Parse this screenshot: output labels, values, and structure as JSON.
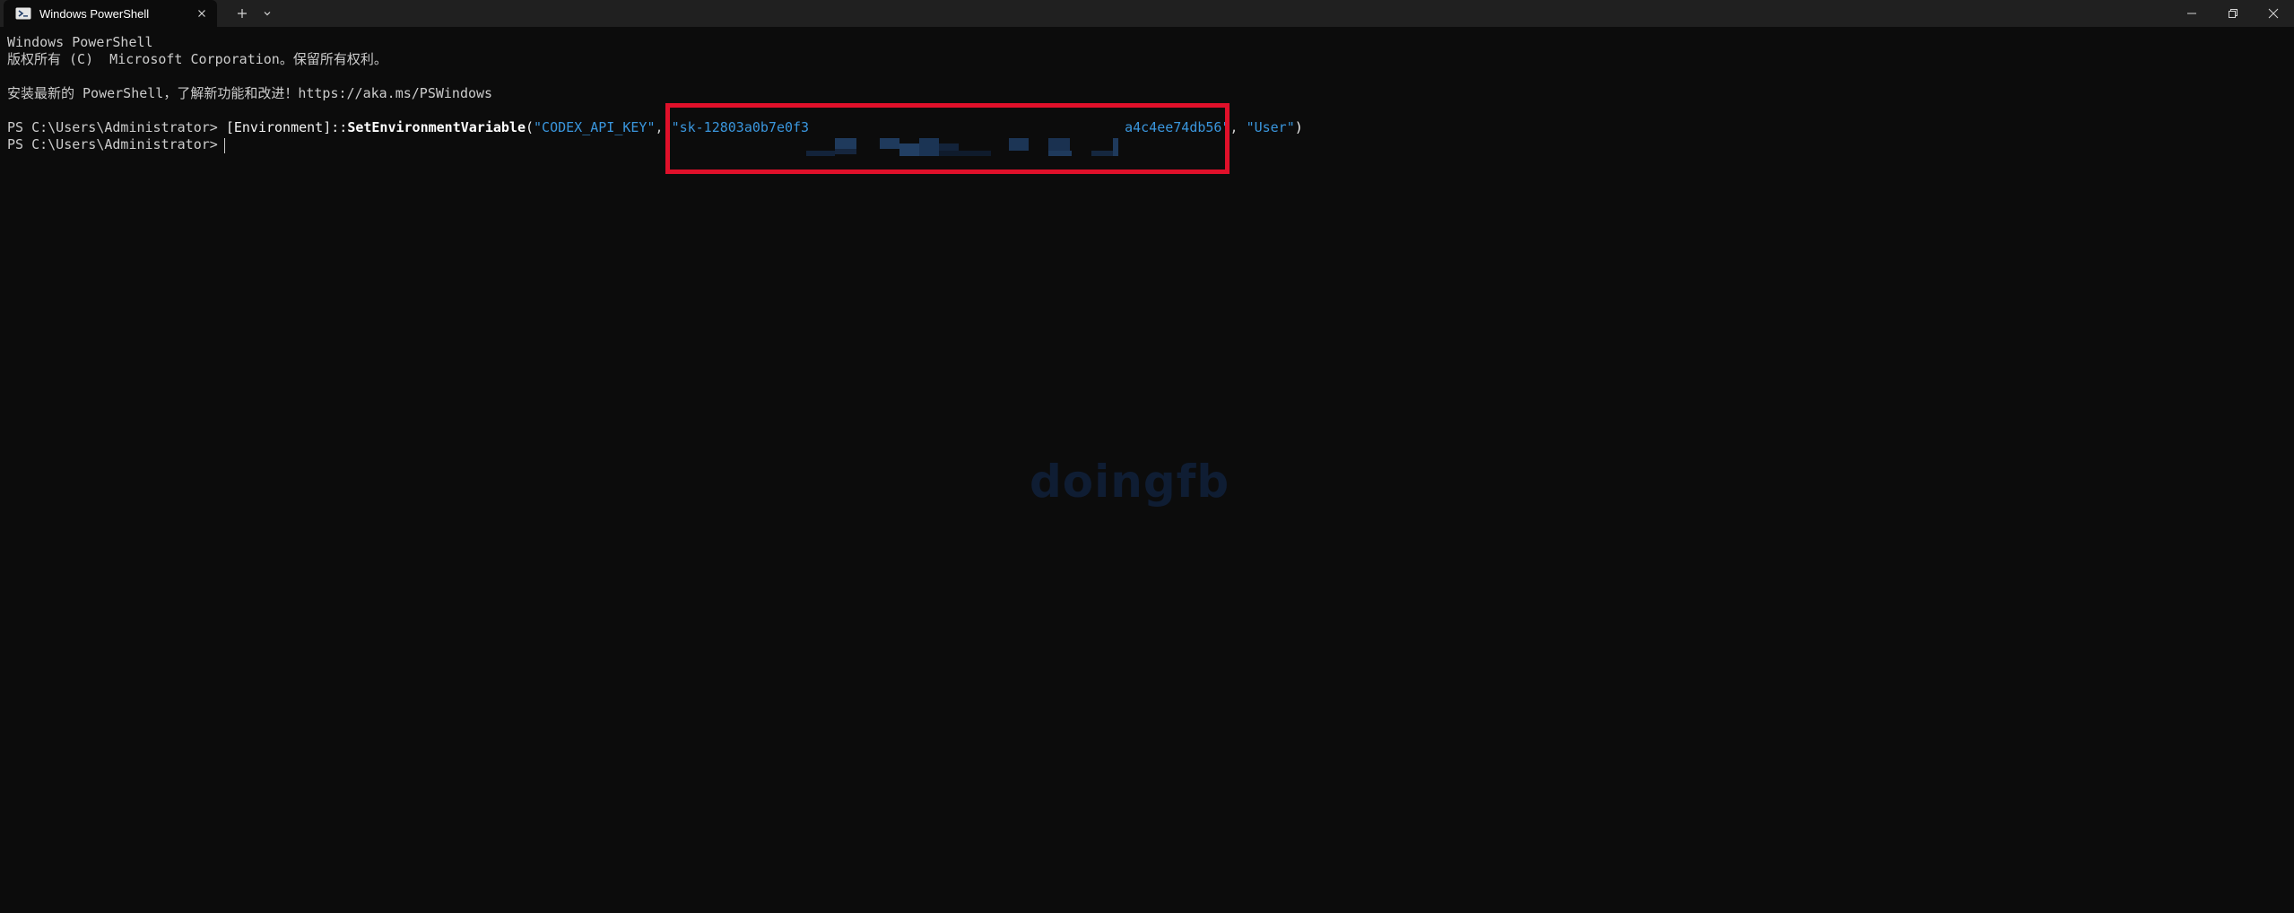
{
  "window": {
    "tab_title": "Windows PowerShell",
    "tab_icon": "powershell-icon",
    "new_tab_icon": "plus-icon",
    "dropdown_icon": "chevron-down-icon",
    "controls": [
      "minimize-icon",
      "restore-icon",
      "close-icon"
    ]
  },
  "terminal": {
    "line1": "Windows PowerShell",
    "line2": "版权所有 (C)  Microsoft Corporation。保留所有权利。",
    "line3": "安装最新的 PowerShell，了解新功能和改进！https://aka.ms/PSWindows",
    "command": {
      "prompt": "PS C:\\Users\\Administrator> ",
      "type_name": "[Environment]::",
      "method": "SetEnvironmentVariable",
      "open_paren": "(",
      "arg1": "\"CODEX_API_KEY\"",
      "sep1": ", ",
      "arg2_start": "\"sk-12803a0b7e0f3",
      "arg2_end": "a4c4ee74db56\"",
      "sep2": ", ",
      "arg3": "\"User\"",
      "close_paren": ")"
    },
    "prompt2": "PS C:\\Users\\Administrator> "
  },
  "watermark": "doingfb",
  "colors": {
    "background": "#0c0c0c",
    "titlebar": "#202020",
    "string": "#3a96dd",
    "highlight_box": "#e0102a"
  }
}
